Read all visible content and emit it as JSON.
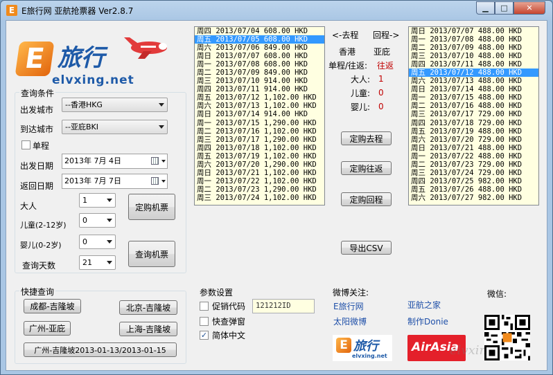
{
  "window": {
    "title": "E旅行网 亚航抢票器  Ver2.8.7",
    "app_icon_letter": "E",
    "buttons": {
      "minimize": "▁",
      "maximize": "□",
      "close": "✕"
    }
  },
  "logo": {
    "cn": "旅行",
    "en": "elvxing.net",
    "letter": "E"
  },
  "query": {
    "group_title": "查询条件",
    "from_label": "出发城市",
    "from_value": "--香港HKG",
    "to_label": "到达城市",
    "to_value": "--亚庇BKI",
    "oneway_label": "单程",
    "oneway_checked": false,
    "depart_label": "出发日期",
    "depart_value": "2013年  7月  4日",
    "return_label": "返回日期",
    "return_value": "2013年  7月  7日",
    "adult_label": "大人",
    "adult_value": "1",
    "child_label": "儿童(2-12岁)",
    "child_value": "0",
    "infant_label": "婴儿(0-2岁)",
    "infant_value": "0",
    "days_label": "查询天数",
    "days_value": "21",
    "book_button": "定购机票",
    "search_button": "查询机票"
  },
  "quick": {
    "group_title": "快捷查询",
    "buttons": [
      "成都-吉隆坡",
      "北京-吉隆坡",
      "广州-亚庇",
      "上海-吉隆坡",
      "广州-吉隆坡2013-01-13/2013-01-15"
    ]
  },
  "outbound_list": {
    "selected_index": 1,
    "rows": [
      "周四 2013/07/04 608.00 HKD",
      "周五 2013/07/05 608.00 HKD",
      "周六 2013/07/06 849.00 HKD",
      "周日 2013/07/07 608.00 HKD",
      "周一 2013/07/08 608.00 HKD",
      "周二 2013/07/09 849.00 HKD",
      "周三 2013/07/10 914.00 HKD",
      "周四 2013/07/11 914.00 HKD",
      "周五 2013/07/12 1,102.00 HKD",
      "周六 2013/07/13 1,102.00 HKD",
      "周日 2013/07/14 914.00 HKD",
      "周一 2013/07/15 1,290.00 HKD",
      "周二 2013/07/16 1,102.00 HKD",
      "周三 2013/07/17 1,290.00 HKD",
      "周四 2013/07/18 1,102.00 HKD",
      "周五 2013/07/19 1,102.00 HKD",
      "周六 2013/07/20 1,290.00 HKD",
      "周日 2013/07/21 1,102.00 HKD",
      "周一 2013/07/22 1,102.00 HKD",
      "周二 2013/07/23 1,290.00 HKD",
      "周三 2013/07/24 1,102.00 HKD"
    ]
  },
  "return_list": {
    "selected_index": 5,
    "rows": [
      "周日 2013/07/07 488.00 HKD",
      "周一 2013/07/08 488.00 HKD",
      "周二 2013/07/09 488.00 HKD",
      "周三 2013/07/10 488.00 HKD",
      "周四 2013/07/11 488.00 HKD",
      "周五 2013/07/12 488.00 HKD",
      "周六 2013/07/13 488.00 HKD",
      "周日 2013/07/14 488.00 HKD",
      "周一 2013/07/15 488.00 HKD",
      "周二 2013/07/16 488.00 HKD",
      "周三 2013/07/17 729.00 HKD",
      "周四 2013/07/18 729.00 HKD",
      "周五 2013/07/19 488.00 HKD",
      "周六 2013/07/20 729.00 HKD",
      "周日 2013/07/21 488.00 HKD",
      "周一 2013/07/22 488.00 HKD",
      "周二 2013/07/23 729.00 HKD",
      "周三 2013/07/24 729.00 HKD",
      "周四 2013/07/25 982.00 HKD",
      "周五 2013/07/26 488.00 HKD",
      "周六 2013/07/27 982.00 HKD"
    ]
  },
  "summary": {
    "outbound_header": "<-去程",
    "return_header": "回程->",
    "from_city": "香港",
    "to_city": "亚庇",
    "trip_label": "单程/往返:",
    "trip_value": "往返",
    "adult_label": "大人:",
    "adult_value": "1",
    "child_label": "儿童:",
    "child_value": "0",
    "infant_label": "婴儿:",
    "infant_value": "0",
    "book_out": "定购去程",
    "book_round": "定购往返",
    "book_return": "定购回程",
    "export": "导出CSV"
  },
  "settings": {
    "group_title": "参数设置",
    "promo_label": "促销代码",
    "promo_checked": false,
    "promo_code": "121212ID",
    "popup_label": "快查弹窗",
    "popup_checked": false,
    "chinese_label": "简体中文",
    "chinese_checked": true
  },
  "social": {
    "weibo_title": "微博关注:",
    "weixin_title": "微信:",
    "links": [
      "E旅行网",
      "亚航之家",
      "太阳微博",
      "制作Donie"
    ],
    "airasia_logo": "AirAsia",
    "watermark": "elvxing.net"
  }
}
